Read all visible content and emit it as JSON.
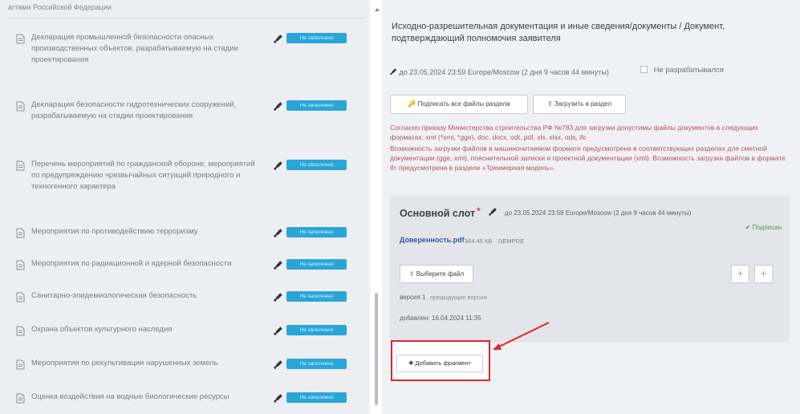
{
  "left_panel": {
    "top_cut_text": "агтами Российской Федерации",
    "badge_label": "Не заполнено",
    "items": [
      {
        "label": "Декларация промышленной безопасности опасных производственных объектов, разрабатываемую на стадии проектирования"
      },
      {
        "label": "Декларация безопасности гидротехнических сооружений, разрабатываемую на стадии проектирования"
      },
      {
        "label": "Перечень мероприятий по гражданской обороне, мероприятий по предупреждению чрезвычайных ситуаций природного и техногенного характера"
      },
      {
        "label": "Мероприятия по противодействию терроризму"
      },
      {
        "label": "Мероприятия по радиационной и ядерной безопасности"
      },
      {
        "label": "Санитарно-эпидемиологическая безопасность"
      },
      {
        "label": "Охрана объектов культурного наследия"
      },
      {
        "label": "Мероприятия по рекультивации нарушенных земель"
      },
      {
        "label": "Оценка воздействия на водные биологические ресурсы"
      }
    ]
  },
  "right_panel": {
    "title": "Исходно-разрешительная документация и иные сведения/документы / Документ, подтверждающий полномочия заявителя",
    "deadline": "до 23.05.2024 23:59 Europe/Moscow (2 дня 9 часов 44 минуты)",
    "not_developed_label": "Не разрабатывался",
    "sign_all_button": "Подписать все файлы раздела",
    "upload_button": "Загрузить в раздел",
    "note_formats": "Согласно приказу Министерства строительства РФ №783 для загрузки допустимы файлы документов в следующих форматах: xml (*xml, *gge), doc, docx, odt, pdf, xls, xlsx, ods, ifc",
    "note_machine": "Возможность загрузки файлов в машиночитаемом формате предусмотрена в соответствующих разделах для сметной документации (gge, xml), пояснительной записки и проектной документации (xml). Возможность загрузки файлов в формате ifc предусмотрена в разделе «Трехмерная модель».",
    "slot": {
      "title": "Основной слот",
      "required_mark": "*",
      "deadline": "до 23.05.2024 23:59 Europe/Moscow (2 дня 9 часов 44 минуты)",
      "signed_label": "✔ Подписан",
      "file_name": "Доверенность.pdf",
      "file_size": "364.45 КБ",
      "file_ext": "DEMPDE",
      "choose_file_button": "Выберите файл",
      "version_text": "версия 1",
      "prev_versions": "предыдущие версии",
      "added_text": "добавлен: 16.04.2024 11:35",
      "plus_label": "+",
      "minus_label": "+"
    },
    "add_fragment_button": "Добавить фрагмент"
  },
  "colors": {
    "badge": "#29a6d9",
    "note_red": "#b0545e",
    "highlight_red": "#e3242b",
    "signed_green": "#4a9b3f",
    "file_link": "#2c5d9a"
  }
}
